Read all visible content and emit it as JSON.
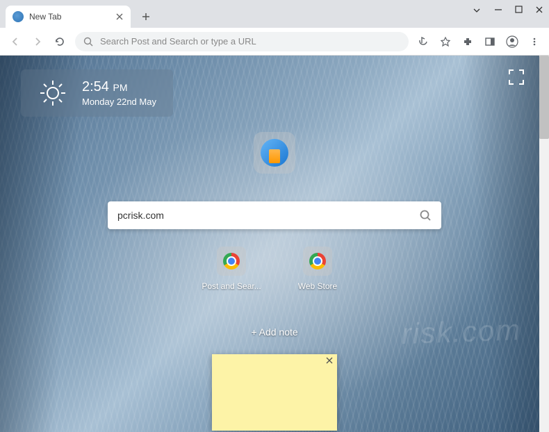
{
  "window": {
    "tab_title": "New Tab"
  },
  "toolbar": {
    "omnibox_placeholder": "Search Post and Search or type a URL"
  },
  "clock": {
    "time": "2:54",
    "period": "PM",
    "date": "Monday 22nd May"
  },
  "search": {
    "query": "pcrisk.com"
  },
  "shortcuts": [
    {
      "label": "Post and Sear..."
    },
    {
      "label": "Web Store"
    }
  ],
  "notes": {
    "add_label": "+ Add note"
  },
  "watermark": "risk.com"
}
